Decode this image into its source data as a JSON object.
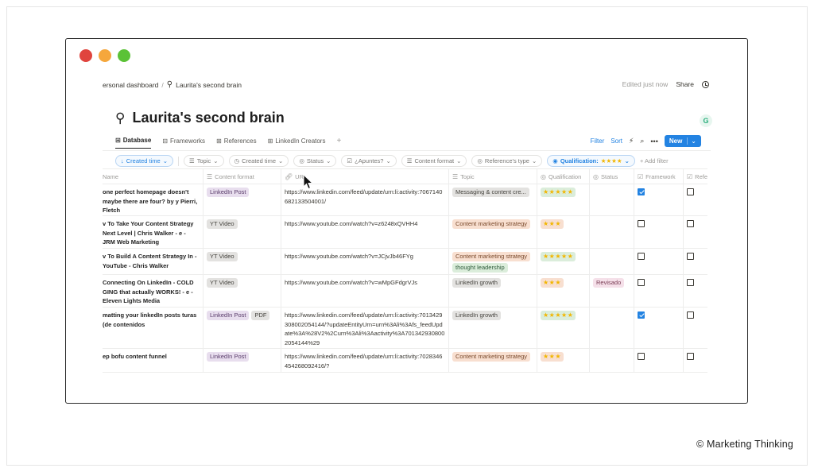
{
  "breadcrumb": {
    "parent": "ersonal dashboard",
    "separator": "/",
    "current": "Laurita's second brain"
  },
  "topbar": {
    "edited": "Edited just now",
    "share": "Share"
  },
  "page": {
    "title": "Laurita's second brain",
    "icon": "brain-icon",
    "side_badge": "G"
  },
  "tabs": [
    {
      "label": "Database",
      "icon": "table-icon"
    },
    {
      "label": "Frameworks",
      "icon": "gallery-icon"
    },
    {
      "label": "References",
      "icon": "table-icon"
    },
    {
      "label": "LinkedIn Creators",
      "icon": "table-icon"
    }
  ],
  "tab_add": "+",
  "toolbar": {
    "filter": "Filter",
    "sort": "Sort",
    "new": "New"
  },
  "filters": {
    "created_time": "Created time",
    "topic": "Topic",
    "created_time2": "Created time",
    "status": "Status",
    "apuntes": "¿Apuntes?",
    "content_format": "Content format",
    "ref_type": "Reference's type",
    "qualification_label": "Qualification:",
    "qualification_stars": "★★★★",
    "add_filter": "+ Add filter"
  },
  "columns": {
    "name": "Name",
    "format": "Content format",
    "url": "URL",
    "topic": "Topic",
    "qualification": "Qualification",
    "status": "Status",
    "framework": "Framework",
    "ref": "Refe"
  },
  "rows": [
    {
      "name": "one perfect homepage doesn't maybe there are four? by y Pierri, Fletch",
      "formats": [
        "LinkedIn Post"
      ],
      "url": "https://www.linkedin.com/feed/update/urn:li:activity:7067140682133504001/",
      "topics": [
        {
          "t": "Messaging & content cre...",
          "c": "gray"
        }
      ],
      "stars": "★★★★★",
      "stars_color": "green",
      "status": "",
      "framework": true,
      "ref": false
    },
    {
      "name": "v To Take Your Content Strategy Next Level | Chris Walker - e - JRM Web Marketing",
      "formats": [
        "YT Video"
      ],
      "url": "https://www.youtube.com/watch?v=z6248xQVHH4",
      "topics": [
        {
          "t": "Content marketing strategy",
          "c": "orange"
        }
      ],
      "stars": "★★★",
      "stars_color": "orange",
      "status": "",
      "framework": false,
      "ref": false
    },
    {
      "name": "v To Build A Content Strategy In - YouTube - Chris Walker",
      "formats": [
        "YT Video"
      ],
      "url": "https://www.youtube.com/watch?v=JCjvJb46FYg",
      "topics": [
        {
          "t": "Content marketing strategy",
          "c": "orange"
        },
        {
          "t": "thought leadership",
          "c": "green"
        }
      ],
      "stars": "★★★★★",
      "stars_color": "green",
      "status": "",
      "framework": false,
      "ref": false
    },
    {
      "name": "Connecting On LinkedIn - COLD GING that actually WORKS! - e - Eleven Lights Media",
      "formats": [
        "YT Video"
      ],
      "url": "https://www.youtube.com/watch?v=wMpGFdgrVJs",
      "topics": [
        {
          "t": "LinkedIn growth",
          "c": "gray"
        }
      ],
      "stars": "★★★",
      "stars_color": "orange",
      "status": "Revisado",
      "framework": false,
      "ref": false
    },
    {
      "name": "matting your linkedIn posts turas de contenidos)",
      "formats": [
        "LinkedIn Post",
        "PDF"
      ],
      "url": "https://www.linkedin.com/feed/update/urn:li:activity:7013429308002054144/?updateEntityUrn=urn%3Ali%3Afs_feedUpdate%3A%28V2%2Curn%3Ali%3Aactivity%3A7013429308002054144%29",
      "topics": [
        {
          "t": "LinkedIn growth",
          "c": "gray"
        }
      ],
      "stars": "★★★★★",
      "stars_color": "green",
      "status": "",
      "framework": true,
      "ref": false
    },
    {
      "name": "ep bofu content funnel",
      "formats": [
        "LinkedIn Post"
      ],
      "url": "https://www.linkedin.com/feed/update/urn:li:activity:7028346454268092416/?",
      "topics": [
        {
          "t": "Content marketing strategy",
          "c": "orange"
        }
      ],
      "stars": "★★★",
      "stars_color": "orange",
      "status": "",
      "framework": false,
      "ref": false
    }
  ],
  "credit": "© Marketing Thinking"
}
